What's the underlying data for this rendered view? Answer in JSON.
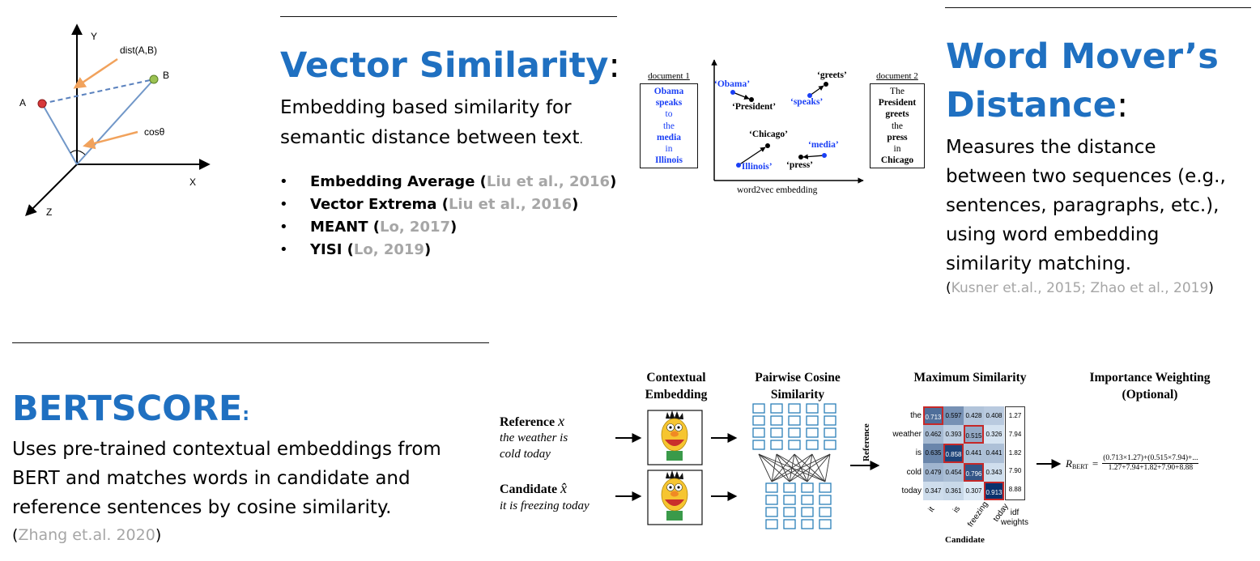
{
  "vector_figure": {
    "y_label": "Y",
    "x_label": "X",
    "z_label": "Z",
    "a_label": "A",
    "b_label": "B",
    "dist_label": "dist(A,B)",
    "cos_label": "cosθ"
  },
  "vector_similarity": {
    "title": "Vector Similarity",
    "colon": ":",
    "desc_line1": "Embedding based similarity for",
    "desc_line2": "semantic distance between text",
    "desc_period": ".",
    "bullet_glyph": "•",
    "items": [
      {
        "name": "Embedding Average",
        "open": " (",
        "cite": "Liu et al., 2016",
        "close": ")"
      },
      {
        "name": "Vector Extrema",
        "open": " (",
        "cite": "Liu et al., 2016",
        "close": ")"
      },
      {
        "name": "MEANT",
        "open": " (",
        "cite": "Lo, 2017",
        "close": ")"
      },
      {
        "name": "YISI",
        "open": " (",
        "cite": "Lo, 2019",
        "close": ")"
      }
    ]
  },
  "w2v_figure": {
    "doc1_title": "document 1",
    "doc1_words": [
      "Obama",
      "speaks",
      "to",
      "the",
      "media",
      "in",
      "Illinois"
    ],
    "doc2_title": "document 2",
    "doc2_words": [
      "The",
      "President",
      "greets",
      "the",
      "press",
      "in",
      "Chicago"
    ],
    "points": {
      "obama": "‘Obama’",
      "president": "‘President’",
      "speaks": "‘speaks’",
      "greets": "‘greets’",
      "chicago": "‘Chicago’",
      "illinois": "‘Illinois’",
      "press": "‘press’",
      "media": "‘media’"
    },
    "axis_caption": "word2vec embedding"
  },
  "word_movers": {
    "title_line1": "Word Mover’s",
    "title_line2": "Distance",
    "colon": ":",
    "desc_lines": [
      "Measures the distance",
      "between two sequences (e.g.,",
      "sentences, paragraphs, etc.),",
      "using word embedding",
      "similarity matching."
    ],
    "cite_open": "(",
    "cite": "Kusner et.al., 2015; Zhao et al., 2019",
    "cite_close": ")"
  },
  "bertscore": {
    "title": "BERTSCORE",
    "colon": ":",
    "desc_lines": [
      "Uses pre-trained contextual embeddings from",
      "BERT and matches words in candidate and",
      "reference sentences by cosine similarity."
    ],
    "cite_open": "(",
    "cite": "Zhang et.al. 2020",
    "cite_close": ")"
  },
  "bert_figure": {
    "ref_label": "Reference",
    "ref_symbol": "x",
    "ref_line1": "the weather is",
    "ref_line2": "cold today",
    "cand_label": "Candidate",
    "cand_symbol": "x̂",
    "cand_line1": "it is freezing today",
    "stage1_l1": "Contextual",
    "stage1_l2": "Embedding",
    "stage2_l1": "Pairwise Cosine",
    "stage2_l2": "Similarity",
    "stage3": "Maximum Similarity",
    "stage4_l1": "Importance Weighting",
    "stage4_l2": "(Optional)",
    "matrix_rows": [
      "the",
      "weather",
      "is",
      "cold",
      "today"
    ],
    "matrix_cols": [
      "it",
      "is",
      "freezing",
      "today"
    ],
    "matrix_values": [
      [
        "0.713",
        "0.597",
        "0.428",
        "0.408"
      ],
      [
        "0.462",
        "0.393",
        "0.515",
        "0.326"
      ],
      [
        "0.635",
        "0.858",
        "0.441",
        "0.441"
      ],
      [
        "0.479",
        "0.454",
        "0.796",
        "0.343"
      ],
      [
        "0.347",
        "0.361",
        "0.307",
        "0.913"
      ]
    ],
    "idf_values": [
      "1.27",
      "7.94",
      "1.82",
      "7.90",
      "8.88"
    ],
    "idf_label_l1": "idf",
    "idf_label_l2": "weights",
    "row_axis": "Reference",
    "col_axis": "Candidate",
    "r_bert": "R",
    "r_bert_sub": "BERT",
    "equals": "=",
    "numerator": "(0.713×1.27)+(0.515×7.94)+...",
    "denominator": "1.27+7.94+1.82+7.90+8.88"
  }
}
